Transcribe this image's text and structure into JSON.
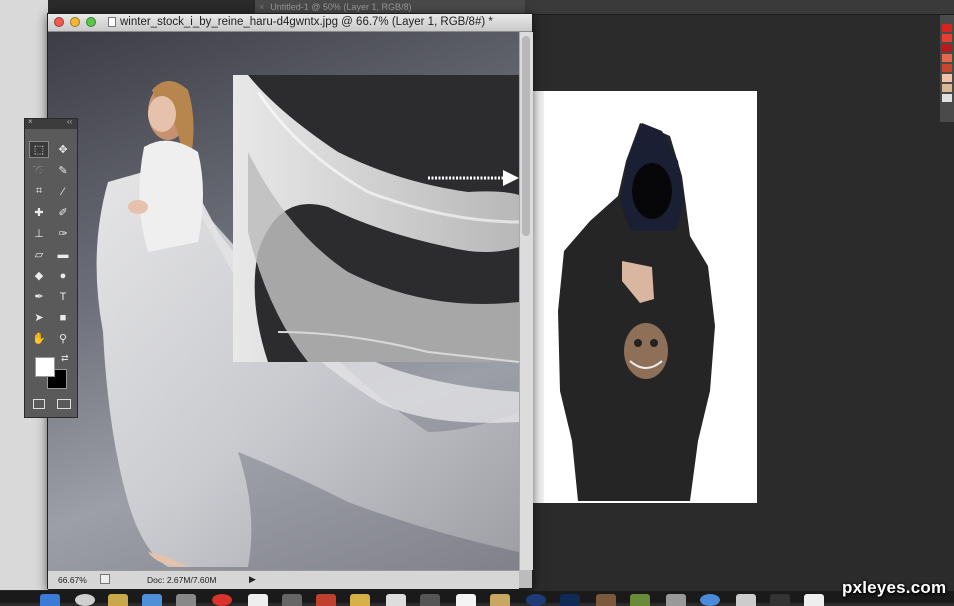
{
  "background_tab": {
    "title": "Untitled-1 @ 50% (Layer 1, RGB/8)"
  },
  "document": {
    "title": "winter_stock_i_by_reine_haru-d4gwntx.jpg @ 66.7% (Layer 1, RGB/8#) *",
    "zoom_level": "66.67%",
    "doc_size": "Doc: 2.67M/7.60M"
  },
  "watermark": "pxleyes.com",
  "colors": {
    "foreground": "#ffffff",
    "background": "#000000",
    "close": "#ee5b52",
    "minimize": "#f5b834",
    "zoom": "#5dc54a"
  },
  "tools": [
    {
      "icon": "marquee-icon",
      "glyph": "⬚"
    },
    {
      "icon": "move-icon",
      "glyph": "✥"
    },
    {
      "icon": "lasso-icon",
      "glyph": "➰"
    },
    {
      "icon": "quick-select-icon",
      "glyph": "✎"
    },
    {
      "icon": "crop-icon",
      "glyph": "⌗"
    },
    {
      "icon": "eyedropper-icon",
      "glyph": "⁄"
    },
    {
      "icon": "healing-icon",
      "glyph": "✚"
    },
    {
      "icon": "brush-icon",
      "glyph": "✐"
    },
    {
      "icon": "stamp-icon",
      "glyph": "⊥"
    },
    {
      "icon": "history-brush-icon",
      "glyph": "✑"
    },
    {
      "icon": "eraser-icon",
      "glyph": "▱"
    },
    {
      "icon": "gradient-icon",
      "glyph": "▬"
    },
    {
      "icon": "blur-icon",
      "glyph": "◆"
    },
    {
      "icon": "dodge-icon",
      "glyph": "●"
    },
    {
      "icon": "pen-icon",
      "glyph": "✒"
    },
    {
      "icon": "type-icon",
      "glyph": "T"
    },
    {
      "icon": "path-select-icon",
      "glyph": "➤"
    },
    {
      "icon": "shape-icon",
      "glyph": "■"
    },
    {
      "icon": "hand-icon",
      "glyph": "✋"
    },
    {
      "icon": "zoom-icon",
      "glyph": "⚲"
    }
  ]
}
